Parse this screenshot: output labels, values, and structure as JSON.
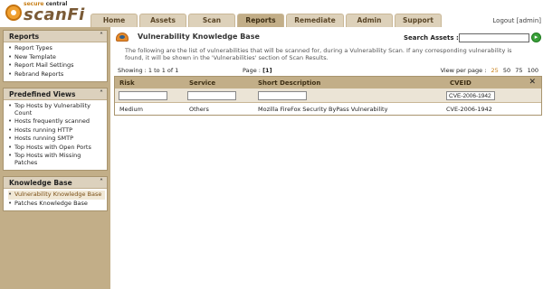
{
  "brand": {
    "small_left": "secure",
    "small_right": "central",
    "big": "scanFi"
  },
  "nav": {
    "tabs": [
      {
        "label": "Home",
        "active": false
      },
      {
        "label": "Assets",
        "active": false
      },
      {
        "label": "Scan",
        "active": false
      },
      {
        "label": "Reports",
        "active": true
      },
      {
        "label": "Remediate",
        "active": false
      },
      {
        "label": "Admin",
        "active": false
      },
      {
        "label": "Support",
        "active": false
      }
    ],
    "logout": "Logout",
    "user": "[admin]"
  },
  "sidebar": {
    "reports": {
      "title": "Reports",
      "items": [
        "Report Types",
        "New Template",
        "Report Mail Settings",
        "Rebrand Reports"
      ]
    },
    "predefined": {
      "title": "Predefined Views",
      "items": [
        "Top Hosts by Vulnerability Count",
        "Hosts frequently scanned",
        "Hosts running HTTP",
        "Hosts running SMTP",
        "Top Hosts with Open Ports",
        "Top Hosts with Missing Patches"
      ]
    },
    "kb": {
      "title": "Knowledge Base",
      "items": [
        "Vulnerability Knowledge Base",
        "Patches Knowledge Base"
      ]
    }
  },
  "main": {
    "title": "Vulnerability Knowledge Base",
    "search_label": "Search Assets :",
    "search_value": "",
    "description": "The following are the list of vulnerabilities that will be scanned for, during a Vulnerability Scan. If any corresponding vulnerability is found, it will be shown in the 'Vulnerabilities' section of Scan Results.",
    "showing": "Showing : 1 to 1 of 1",
    "page_label": "Page :",
    "page_value": "[1]",
    "view_per_page_label": "View per page :",
    "view_per_page_options": [
      "25",
      "50",
      "75",
      "100"
    ],
    "view_per_page_current": "25"
  },
  "grid": {
    "columns": [
      "Risk",
      "Service",
      "Short Description",
      "CVEID"
    ],
    "filters": [
      "",
      "",
      "",
      "CVE-2006-1942"
    ],
    "rows": [
      [
        "Medium",
        "Others",
        "Mozilla FireFox Security ByPass Vulnerability",
        "CVE-2006-1942"
      ]
    ]
  },
  "colors": {
    "sidebar_bg": "#c2ae88",
    "accent": "#c8801a"
  }
}
